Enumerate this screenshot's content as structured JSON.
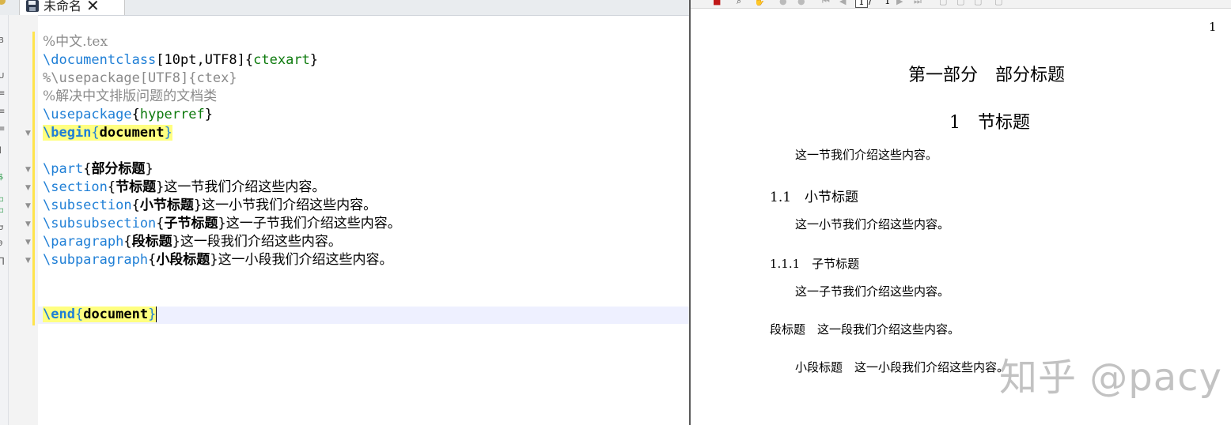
{
  "editor": {
    "tab": {
      "label": "未命名"
    },
    "lines": [
      {
        "text": "%中文.tex"
      },
      {
        "cmd": "\\documentclass",
        "opt": "[10pt,UTF8]",
        "arg": "ctexart"
      },
      {
        "text": "%\\usepackage[UTF8]{ctex}"
      },
      {
        "text": "%解决中文排版问题的文档类"
      },
      {
        "cmd": "\\usepackage",
        "arg": "hyperref"
      },
      {
        "cmd": "\\begin",
        "arg": "document"
      },
      {
        "cmd": "\\part",
        "arg": "部分标题",
        "tail": ""
      },
      {
        "cmd": "\\section",
        "arg": "节标题",
        "tail": "这一节我们介绍这些内容。"
      },
      {
        "cmd": "\\subsection",
        "arg": "小节标题",
        "tail": "这一小节我们介绍这些内容。"
      },
      {
        "cmd": "\\subsubsection",
        "arg": "子节标题",
        "tail": "这一子节我们介绍这些内容。"
      },
      {
        "cmd": "\\paragraph",
        "arg": "段标题",
        "tail": "这一段我们介绍这些内容。"
      },
      {
        "cmd": "\\subparagraph",
        "arg": "小段标题",
        "tail": "这一小段我们介绍这些内容。"
      },
      {
        "cmd": "\\end",
        "arg": "document"
      }
    ]
  },
  "preview": {
    "toolbar": {
      "page_current": "1",
      "page_separator": "/",
      "page_total": "1"
    },
    "page_number": "1",
    "part_title": "第一部分　部分标题",
    "section_title": "1　节标题",
    "section_body": "这一节我们介绍这些内容。",
    "subsection_title": "1.1　小节标题",
    "subsection_body": "这一小节我们介绍这些内容。",
    "subsubsection_title": "1.1.1　子节标题",
    "subsubsection_body": "这一子节我们介绍这些内容。",
    "paragraph_title": "段标题",
    "paragraph_body": "这一段我们介绍这些内容。",
    "subparagraph_title": "小段标题",
    "subparagraph_body": "这一小段我们介绍这些内容。",
    "watermark": "知乎 @pacy"
  }
}
